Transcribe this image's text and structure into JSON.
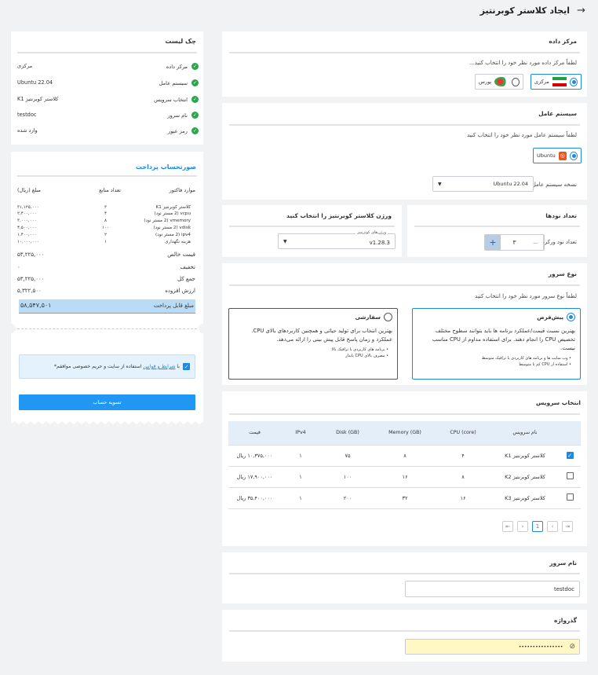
{
  "page": {
    "title": "ایجاد کلاستر کوبرنتیز",
    "back_icon": "arrow-right-icon"
  },
  "datacenter": {
    "title": "مرکز داده",
    "hint": "لطفاً مرکز داده مورد نظر خود را انتخاب کنید...",
    "options": [
      {
        "label": "مرکزی",
        "flag": "iran-flag-icon",
        "selected": true
      },
      {
        "label": "پورس",
        "flag": "pars-logo-icon",
        "selected": false
      }
    ]
  },
  "os": {
    "title": "سیستم عامل",
    "hint": "لطفاً سیستم عامل مورد نظر خود را انتخاب کنید",
    "option_label": "Ubuntu",
    "version_label": "نسخه سیستم عامل:",
    "version_value": "Ubuntu 22.04"
  },
  "nodes": {
    "title": "تعداد نودها",
    "worker_label": "تعداد نود ورکر",
    "worker_value": "۳",
    "plus": "+",
    "minus": "—"
  },
  "k8s_version": {
    "title": "ورژن کلاستر کوبرنتیز را انتخاب کنید",
    "field_label": "ورژن‌های کوبرنتیز",
    "value": "v1.28.3"
  },
  "server_type": {
    "title": "نوع سرور",
    "hint": "لطفاً نوع سرور مورد نظر خود را انتخاب کنید",
    "default": {
      "label": "پیش‌فرض",
      "desc": "بهترین نسبت قیمت/عملکرد برنامه ها باید بتوانند سطوح مختلف تخصیص CPU را انجام دهند. برای استفاده مداوم از CPU مناسب نیست.",
      "bullets": [
        "وب سایت ها و برنامه های کاربردی با ترافیک متوسط",
        "استفاده از CPU کم تا متوسط"
      ]
    },
    "custom": {
      "label": "سفارشی",
      "desc": "بهترین انتخاب برای تولید حیاتی و همچنین کاربردهای بالای CPU. عملکرد و زمان پاسخ قابل پیش بینی را ارائه می‌دهد.",
      "bullets": [
        "برنامه های کاربردی با ترافیک بالا",
        "مصرف بالای CPU پایدار"
      ]
    }
  },
  "service": {
    "title": "انتخاب سرویس",
    "headers": [
      "نام سرویس",
      "CPU (core)",
      "Memory (GB)",
      "Disk (GB)",
      "IPv4",
      "قیمت"
    ],
    "rows": [
      {
        "name": "کلاستر کوبرنتیز K1",
        "cpu": "۴",
        "mem": "۸",
        "disk": "۷۵",
        "ipv4": "۱",
        "price": "۱۰,۳۷۵,۰۰۰ ریال",
        "checked": true
      },
      {
        "name": "کلاستر کوبرنتیز K2",
        "cpu": "۸",
        "mem": "۱۶",
        "disk": "۱۰۰",
        "ipv4": "۱",
        "price": "۱۷,۹۰۰,۰۰۰ ریال",
        "checked": false
      },
      {
        "name": "کلاستر کوبرنتیز K3",
        "cpu": "۱۶",
        "mem": "۳۲",
        "disk": "۲۰۰",
        "ipv4": "۱",
        "price": "۳۵,۴۰۰,۰۰۰ ریال",
        "checked": false
      }
    ],
    "current_page": "1"
  },
  "server_name": {
    "title": "نام سرور",
    "value": "testdoc"
  },
  "password": {
    "title": "گذرواژه",
    "value": "••••••••••••••••"
  },
  "checklist": {
    "title": "چک لیست",
    "items": [
      {
        "label": "مرکز داده",
        "value": "مرکزی"
      },
      {
        "label": "سیستم عامل",
        "value": "Ubuntu 22.04"
      },
      {
        "label": "انتخاب سرویس",
        "value": "کلاستر کوبرنتیز K1"
      },
      {
        "label": "نام سرور",
        "value": "testdoc"
      },
      {
        "label": "رمز عبور",
        "value": "وارد شده"
      }
    ]
  },
  "invoice": {
    "title": "صورتحساب پرداخت",
    "headers": [
      "موارد فاکتور",
      "تعداد منابع",
      "مبلغ (ریال)"
    ],
    "lines": [
      {
        "item": "کلاستر کوبرنتیز K1",
        "qty": "۳",
        "amount": "۳۱,۱۲۵,۰۰۰"
      },
      {
        "item": "vcpu (2 مستر نود)",
        "qty": "۴",
        "amount": "۲,۴۰۰,۰۰۰"
      },
      {
        "item": "vmemory (2 مستر نود)",
        "qty": "۸",
        "amount": "۳,۰۰۰,۰۰۰"
      },
      {
        "item": "vdisk (2 مستر نود)",
        "qty": "۱۰۰",
        "amount": "۴,۵۰۰,۰۰۰"
      },
      {
        "item": "ipv4 (2 مستر نود)",
        "qty": "۲",
        "amount": "۱,۴۰۰,۰۰۰"
      },
      {
        "item": "هزینه نگهداری",
        "qty": "۱",
        "amount": "۱۰,۰۰۰,۰۰۰"
      }
    ],
    "net_label": "قیمت خالص",
    "net": "۵۳,۲۲۵,۰۰۰",
    "discount_label": "تخفیف",
    "discount": "۰",
    "total_label": "جمع کل",
    "total": "۵۳,۲۲۵,۰۰۰",
    "vat_label": "ارزش افزوده",
    "vat": "۵,۳۲۲,۵۰۰",
    "payable_label": "مبلغ قابل پرداخت",
    "payable": "۵۸,۵۴۷,۵۰۱",
    "terms_pre": "با",
    "terms_link": "شرایط و قوانین",
    "terms_post": "استفاده از سایت و حریم خصوصی موافقم*",
    "pay_button": "تسویه حساب"
  },
  "colors": {
    "accent": "#1e88e5",
    "success": "#2ea44f",
    "highlight": "#b8dcf7",
    "password_bg": "#fff8c5"
  }
}
